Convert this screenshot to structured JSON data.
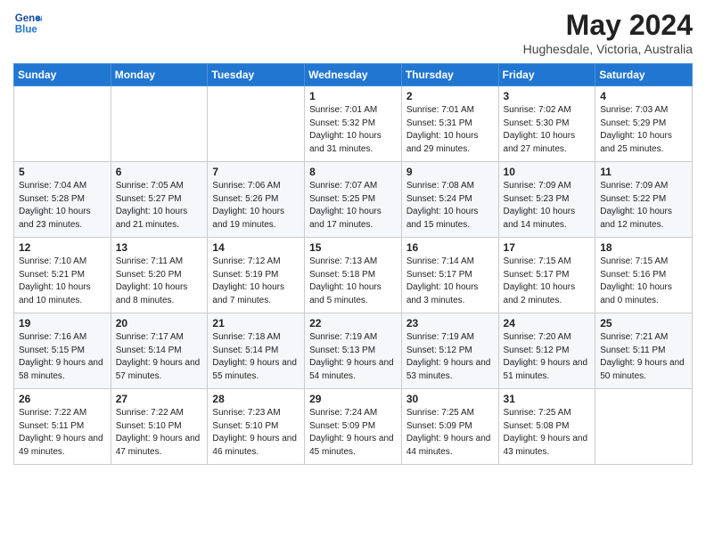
{
  "header": {
    "logo_line1": "General",
    "logo_line2": "Blue",
    "month_year": "May 2024",
    "location": "Hughesdale, Victoria, Australia"
  },
  "weekdays": [
    "Sunday",
    "Monday",
    "Tuesday",
    "Wednesday",
    "Thursday",
    "Friday",
    "Saturday"
  ],
  "weeks": [
    [
      {
        "day": "",
        "sunrise": "",
        "sunset": "",
        "daylight": ""
      },
      {
        "day": "",
        "sunrise": "",
        "sunset": "",
        "daylight": ""
      },
      {
        "day": "",
        "sunrise": "",
        "sunset": "",
        "daylight": ""
      },
      {
        "day": "1",
        "sunrise": "Sunrise: 7:01 AM",
        "sunset": "Sunset: 5:32 PM",
        "daylight": "Daylight: 10 hours and 31 minutes."
      },
      {
        "day": "2",
        "sunrise": "Sunrise: 7:01 AM",
        "sunset": "Sunset: 5:31 PM",
        "daylight": "Daylight: 10 hours and 29 minutes."
      },
      {
        "day": "3",
        "sunrise": "Sunrise: 7:02 AM",
        "sunset": "Sunset: 5:30 PM",
        "daylight": "Daylight: 10 hours and 27 minutes."
      },
      {
        "day": "4",
        "sunrise": "Sunrise: 7:03 AM",
        "sunset": "Sunset: 5:29 PM",
        "daylight": "Daylight: 10 hours and 25 minutes."
      }
    ],
    [
      {
        "day": "5",
        "sunrise": "Sunrise: 7:04 AM",
        "sunset": "Sunset: 5:28 PM",
        "daylight": "Daylight: 10 hours and 23 minutes."
      },
      {
        "day": "6",
        "sunrise": "Sunrise: 7:05 AM",
        "sunset": "Sunset: 5:27 PM",
        "daylight": "Daylight: 10 hours and 21 minutes."
      },
      {
        "day": "7",
        "sunrise": "Sunrise: 7:06 AM",
        "sunset": "Sunset: 5:26 PM",
        "daylight": "Daylight: 10 hours and 19 minutes."
      },
      {
        "day": "8",
        "sunrise": "Sunrise: 7:07 AM",
        "sunset": "Sunset: 5:25 PM",
        "daylight": "Daylight: 10 hours and 17 minutes."
      },
      {
        "day": "9",
        "sunrise": "Sunrise: 7:08 AM",
        "sunset": "Sunset: 5:24 PM",
        "daylight": "Daylight: 10 hours and 15 minutes."
      },
      {
        "day": "10",
        "sunrise": "Sunrise: 7:09 AM",
        "sunset": "Sunset: 5:23 PM",
        "daylight": "Daylight: 10 hours and 14 minutes."
      },
      {
        "day": "11",
        "sunrise": "Sunrise: 7:09 AM",
        "sunset": "Sunset: 5:22 PM",
        "daylight": "Daylight: 10 hours and 12 minutes."
      }
    ],
    [
      {
        "day": "12",
        "sunrise": "Sunrise: 7:10 AM",
        "sunset": "Sunset: 5:21 PM",
        "daylight": "Daylight: 10 hours and 10 minutes."
      },
      {
        "day": "13",
        "sunrise": "Sunrise: 7:11 AM",
        "sunset": "Sunset: 5:20 PM",
        "daylight": "Daylight: 10 hours and 8 minutes."
      },
      {
        "day": "14",
        "sunrise": "Sunrise: 7:12 AM",
        "sunset": "Sunset: 5:19 PM",
        "daylight": "Daylight: 10 hours and 7 minutes."
      },
      {
        "day": "15",
        "sunrise": "Sunrise: 7:13 AM",
        "sunset": "Sunset: 5:18 PM",
        "daylight": "Daylight: 10 hours and 5 minutes."
      },
      {
        "day": "16",
        "sunrise": "Sunrise: 7:14 AM",
        "sunset": "Sunset: 5:17 PM",
        "daylight": "Daylight: 10 hours and 3 minutes."
      },
      {
        "day": "17",
        "sunrise": "Sunrise: 7:15 AM",
        "sunset": "Sunset: 5:17 PM",
        "daylight": "Daylight: 10 hours and 2 minutes."
      },
      {
        "day": "18",
        "sunrise": "Sunrise: 7:15 AM",
        "sunset": "Sunset: 5:16 PM",
        "daylight": "Daylight: 10 hours and 0 minutes."
      }
    ],
    [
      {
        "day": "19",
        "sunrise": "Sunrise: 7:16 AM",
        "sunset": "Sunset: 5:15 PM",
        "daylight": "Daylight: 9 hours and 58 minutes."
      },
      {
        "day": "20",
        "sunrise": "Sunrise: 7:17 AM",
        "sunset": "Sunset: 5:14 PM",
        "daylight": "Daylight: 9 hours and 57 minutes."
      },
      {
        "day": "21",
        "sunrise": "Sunrise: 7:18 AM",
        "sunset": "Sunset: 5:14 PM",
        "daylight": "Daylight: 9 hours and 55 minutes."
      },
      {
        "day": "22",
        "sunrise": "Sunrise: 7:19 AM",
        "sunset": "Sunset: 5:13 PM",
        "daylight": "Daylight: 9 hours and 54 minutes."
      },
      {
        "day": "23",
        "sunrise": "Sunrise: 7:19 AM",
        "sunset": "Sunset: 5:12 PM",
        "daylight": "Daylight: 9 hours and 53 minutes."
      },
      {
        "day": "24",
        "sunrise": "Sunrise: 7:20 AM",
        "sunset": "Sunset: 5:12 PM",
        "daylight": "Daylight: 9 hours and 51 minutes."
      },
      {
        "day": "25",
        "sunrise": "Sunrise: 7:21 AM",
        "sunset": "Sunset: 5:11 PM",
        "daylight": "Daylight: 9 hours and 50 minutes."
      }
    ],
    [
      {
        "day": "26",
        "sunrise": "Sunrise: 7:22 AM",
        "sunset": "Sunset: 5:11 PM",
        "daylight": "Daylight: 9 hours and 49 minutes."
      },
      {
        "day": "27",
        "sunrise": "Sunrise: 7:22 AM",
        "sunset": "Sunset: 5:10 PM",
        "daylight": "Daylight: 9 hours and 47 minutes."
      },
      {
        "day": "28",
        "sunrise": "Sunrise: 7:23 AM",
        "sunset": "Sunset: 5:10 PM",
        "daylight": "Daylight: 9 hours and 46 minutes."
      },
      {
        "day": "29",
        "sunrise": "Sunrise: 7:24 AM",
        "sunset": "Sunset: 5:09 PM",
        "daylight": "Daylight: 9 hours and 45 minutes."
      },
      {
        "day": "30",
        "sunrise": "Sunrise: 7:25 AM",
        "sunset": "Sunset: 5:09 PM",
        "daylight": "Daylight: 9 hours and 44 minutes."
      },
      {
        "day": "31",
        "sunrise": "Sunrise: 7:25 AM",
        "sunset": "Sunset: 5:08 PM",
        "daylight": "Daylight: 9 hours and 43 minutes."
      },
      {
        "day": "",
        "sunrise": "",
        "sunset": "",
        "daylight": ""
      }
    ]
  ]
}
